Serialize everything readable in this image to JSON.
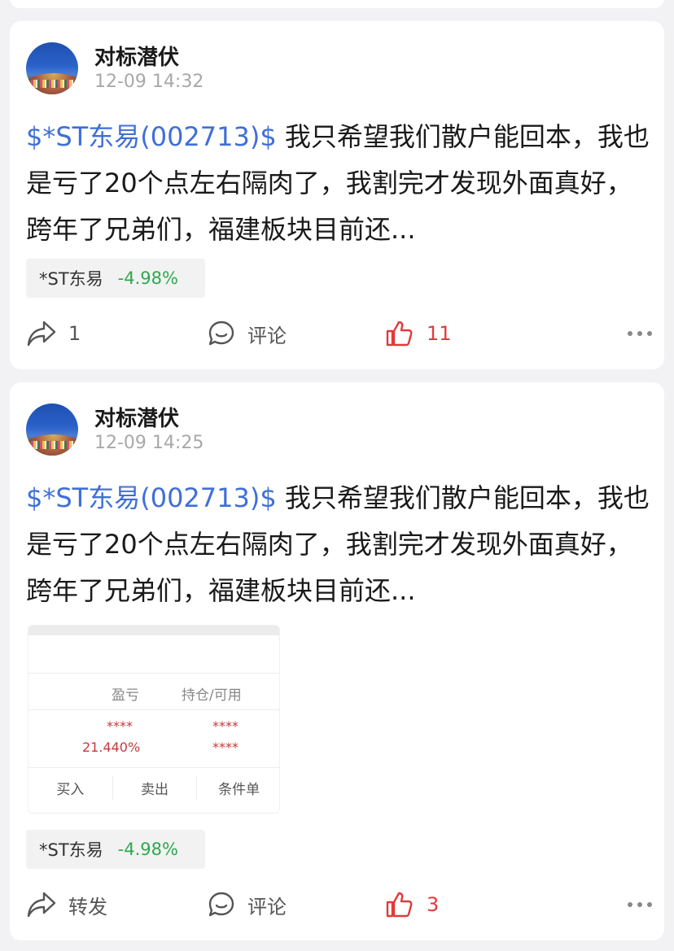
{
  "posts": [
    {
      "username": "对标潜伏",
      "time": "12-09 14:32",
      "stock_tag": "$*ST东易(002713)$",
      "text": " 我只希望我们散户能回本，我也是亏了20个点左右隔肉了，我割完才发现外面真好，跨年了兄弟们，福建板块目前还...",
      "stock_chip": {
        "name": "*ST东易",
        "change": "-4.98%"
      },
      "actions": {
        "share": "1",
        "comment": "评论",
        "like": "11"
      }
    },
    {
      "username": "对标潜伏",
      "time": "12-09 14:25",
      "stock_tag": "$*ST东易(002713)$",
      "text": " 我只希望我们散户能回本，我也是亏了20个点左右隔肉了，我割完才发现外面真好，跨年了兄弟们，福建板块目前还...",
      "attachment": {
        "col_pnl": "盈亏",
        "col_position": "持仓/可用",
        "masked_1": "****",
        "masked_2": "****",
        "masked_3": "****",
        "pnl_pct": "21.440%",
        "btn_buy": "买入",
        "btn_sell": "卖出",
        "btn_conditional": "条件单"
      },
      "stock_chip": {
        "name": "*ST东易",
        "change": "-4.98%"
      },
      "actions": {
        "share": "转发",
        "comment": "评论",
        "like": "3"
      }
    }
  ],
  "colors": {
    "tag_blue": "#3f6fd8",
    "down_green": "#2fa84f",
    "like_red": "#e03a3a",
    "background": "#f2f2f4"
  },
  "icons": [
    "share-icon",
    "comment-icon",
    "like-icon",
    "more-icon"
  ]
}
